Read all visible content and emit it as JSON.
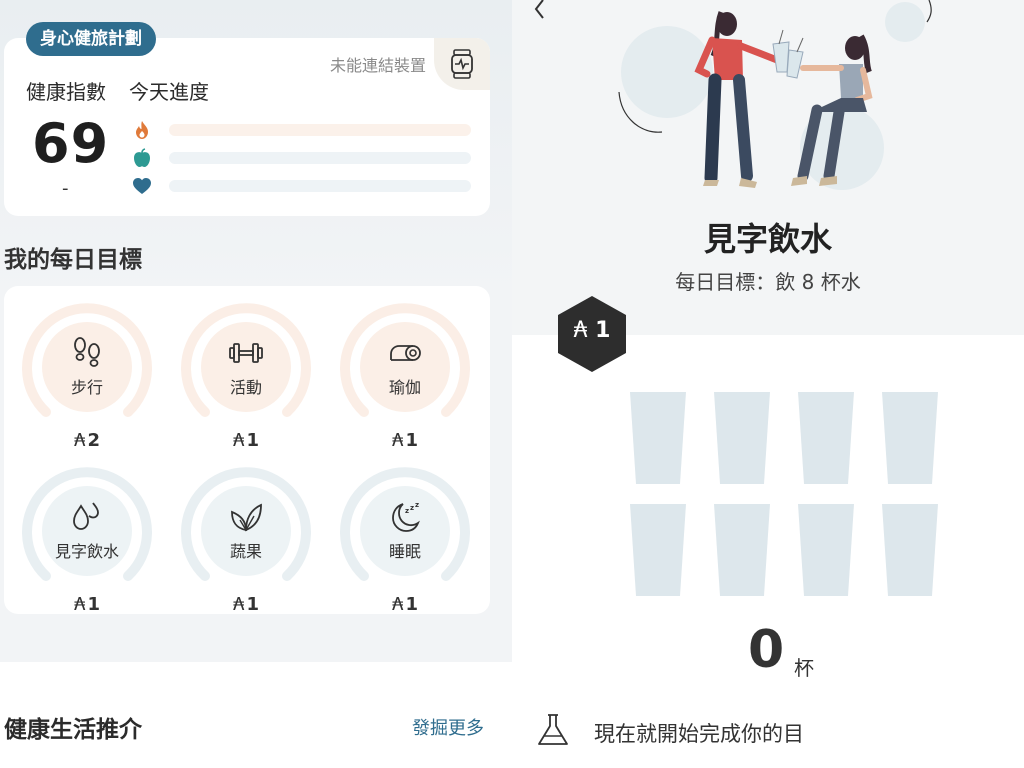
{
  "left": {
    "plan_pill": "身心健旅計劃",
    "device_status": "未能連結裝置",
    "health_index_label": "健康指數",
    "today_progress_label": "今天進度",
    "health_index_value": "69",
    "health_index_change": "-",
    "progress": [
      {
        "icon": "flame-icon",
        "color": "#e07a3a",
        "track": "#fbf1ea",
        "fraction": 0
      },
      {
        "icon": "apple-icon",
        "color": "#2d9a93",
        "track": "#eef3f6",
        "fraction": 0
      },
      {
        "icon": "heart-icon",
        "color": "#2f6d8e",
        "track": "#eef3f6",
        "fraction": 0
      }
    ],
    "goals_title": "我的每日目標",
    "goals": [
      {
        "name": "步行",
        "points": "2",
        "icon": "footprints-icon",
        "ring": "#fbeee6",
        "inner": "#fbefe7"
      },
      {
        "name": "活動",
        "points": "1",
        "icon": "dumbbell-icon",
        "ring": "#fbeee6",
        "inner": "#fbefe7"
      },
      {
        "name": "瑜伽",
        "points": "1",
        "icon": "yoga-mat-icon",
        "ring": "#fbeee6",
        "inner": "#fbefe7"
      },
      {
        "name": "見字飲水",
        "points": "1",
        "icon": "water-drops-icon",
        "ring": "#e8eff2",
        "inner": "#edf3f5"
      },
      {
        "name": "蔬果",
        "points": "1",
        "icon": "leaves-icon",
        "ring": "#e8eff2",
        "inner": "#edf3f5"
      },
      {
        "name": "睡眠",
        "points": "1",
        "icon": "moon-sleep-icon",
        "ring": "#e8eff2",
        "inner": "#edf3f5"
      }
    ],
    "points_symbol": "₳",
    "reco_title": "健康生活推介",
    "reco_more": "發掘更多"
  },
  "right": {
    "title": "見字飲水",
    "subtitle": "每日目標：飲 8 杯水",
    "badge_symbol": "₳",
    "badge_points": "1",
    "cups_total": 8,
    "cups_filled": 0,
    "count": "0",
    "count_unit": "杯",
    "hint": "現在就開始完成你的目"
  },
  "colors": {
    "brand": "#2f6d8e",
    "badge": "#2d2d2d",
    "cup": "#dde7ec"
  }
}
